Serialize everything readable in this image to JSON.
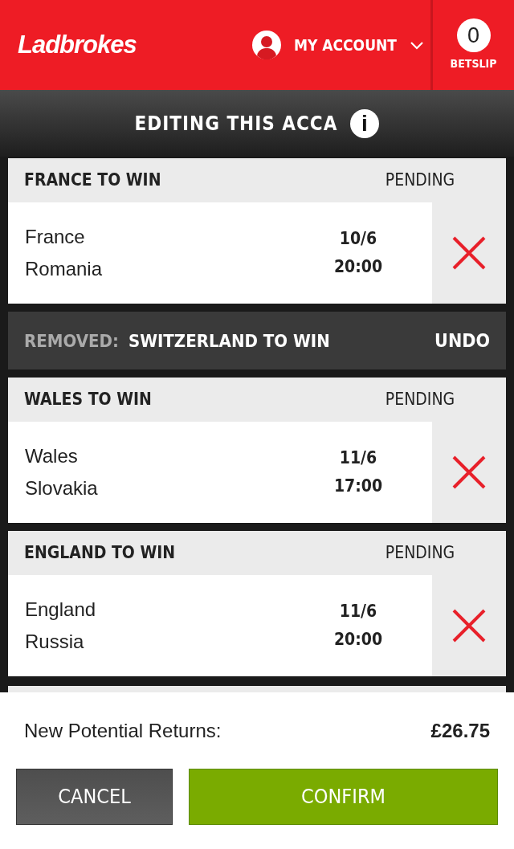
{
  "header": {
    "logo": "Ladbrokes",
    "account_label": "MY ACCOUNT",
    "betslip_count": "0",
    "betslip_label": "BETSLIP"
  },
  "banner": {
    "title": "EDITING THIS ACCA",
    "info_icon": "i"
  },
  "selections": [
    {
      "kind": "bet",
      "title": "FRANCE TO WIN",
      "status": "PENDING",
      "home": "France",
      "away": "Romania",
      "date": "10/6",
      "time": "20:00"
    },
    {
      "kind": "removed",
      "removed_label": "REMOVED:",
      "title": "SWITZERLAND TO WIN",
      "action": "UNDO"
    },
    {
      "kind": "bet",
      "title": "WALES TO WIN",
      "status": "PENDING",
      "home": "Wales",
      "away": "Slovakia",
      "date": "11/6",
      "time": "17:00"
    },
    {
      "kind": "bet",
      "title": "ENGLAND TO WIN",
      "status": "PENDING",
      "home": "England",
      "away": "Russia",
      "date": "11/6",
      "time": "20:00"
    }
  ],
  "footer": {
    "returns_label": "New Potential Returns:",
    "returns_value": "£26.75",
    "cancel": "CANCEL",
    "confirm": "CONFIRM"
  }
}
